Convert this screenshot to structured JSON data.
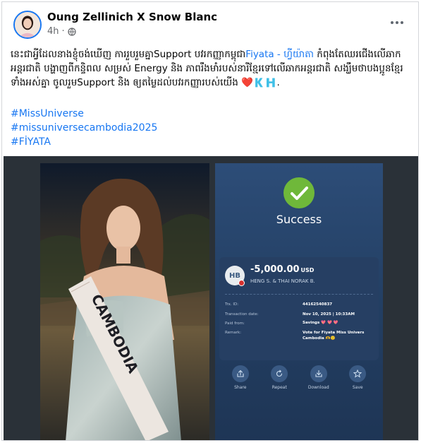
{
  "post": {
    "author": "Oung Zellinich X Snow Blanc",
    "time": "4h",
    "audience_icon": "globe-icon",
    "more_icon": "more-options-icon",
    "body_part1": "នេះជាអ្វីដែលនាងខ្ញុំចង់ឃើញ ការរួបរួមគ្នាSupport បវរកញ្ញាកម្ពុជា",
    "body_link": "Fiyata - ហ្វីយ៉ាតា",
    "body_part2": " កំពុងតែឈរជើងលើឆាកអន្តរជាតិ បង្ហាញពីកន្ទិពល សម្រស់ Energy និង ភាពរឹងមាំរបស់នារីខ្មែរទៅលើឆាកអន្តរជាតិ សង្ឃឹមថាបងប្អូនខ្មែរទាំងអស់គ្នា ចូលរួមSupport និង ឲ្យតម្លៃដល់បវរកញ្ញារបស់យើង ❤️🇰🇭.",
    "hashtags": [
      "#MissUniverse",
      "#missuniversecambodia2025",
      "#FİYATA"
    ]
  },
  "photo": {
    "sash_text": "CAMBODIA"
  },
  "receipt": {
    "status": "Success",
    "avatar_initials": "HB",
    "amount": "-5,000.00",
    "currency": "USD",
    "payee": "HENG S. & THAI NORAK B.",
    "details": [
      {
        "label": "Trx. ID:",
        "value": "44162540837"
      },
      {
        "label": "Transaction date:",
        "value": "Nov 10, 2025 | 10:33AM"
      },
      {
        "label": "Paid from:",
        "value": "Savings 💖 💖 💖"
      },
      {
        "label": "Remark:",
        "value": "Vote for Fiyata Miss Univers Cambodia 🫶🙂"
      }
    ],
    "actions": [
      {
        "label": "Share",
        "icon": "share-icon"
      },
      {
        "label": "Repeat",
        "icon": "repeat-icon"
      },
      {
        "label": "Download",
        "icon": "download-icon"
      },
      {
        "label": "Save",
        "icon": "star-icon"
      }
    ],
    "colors": {
      "success": "#6fb83a",
      "card": "#263f63",
      "background": "#2d4d78"
    }
  },
  "colors": {
    "link": "#1877f2",
    "secondary_text": "#65676b"
  }
}
